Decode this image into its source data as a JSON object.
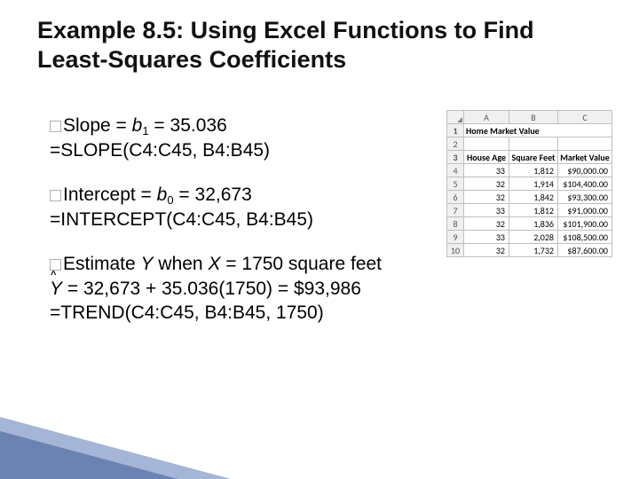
{
  "title": "Example 8.5: Using Excel Functions to Find Least-Squares Coefficients",
  "slope": {
    "label": "Slope",
    "coef": "b",
    "subidx": "1",
    "value": "35.036",
    "formula": "=SLOPE(C4:C45, B4:B45)"
  },
  "intercept": {
    "label": "Intercept",
    "coef": "b",
    "subidx": "0",
    "value": "32,673",
    "formula": "=INTERCEPT(C4:C45, B4:B45)"
  },
  "estimate": {
    "label": "Estimate",
    "line1_a": " when ",
    "Yvar": "Y",
    "Xvar": "X",
    "xval": " = 1750 square feet",
    "eqline": " = 32,673 + 35.036(1750) = $93,986",
    "formula": "=TREND(C4:C45, B4:B45, 1750)"
  },
  "excel": {
    "cols": [
      "A",
      "B",
      "C"
    ],
    "header_row_num": "1",
    "headers": [
      "Home Market Value",
      "",
      ""
    ],
    "row2_num": "2",
    "row3_num": "3",
    "subheaders": [
      "House Age",
      "Square Feet",
      "Market Value"
    ],
    "rows": [
      {
        "n": "4",
        "a": "33",
        "b": "1,812",
        "c": "$90,000.00"
      },
      {
        "n": "5",
        "a": "32",
        "b": "1,914",
        "c": "$104,400.00"
      },
      {
        "n": "6",
        "a": "32",
        "b": "1,842",
        "c": "$93,300.00"
      },
      {
        "n": "7",
        "a": "33",
        "b": "1,812",
        "c": "$91,000.00"
      },
      {
        "n": "8",
        "a": "32",
        "b": "1,836",
        "c": "$101,900.00"
      },
      {
        "n": "9",
        "a": "33",
        "b": "2,028",
        "c": "$108,500.00"
      },
      {
        "n": "10",
        "a": "32",
        "b": "1,732",
        "c": "$87,600.00"
      }
    ]
  }
}
